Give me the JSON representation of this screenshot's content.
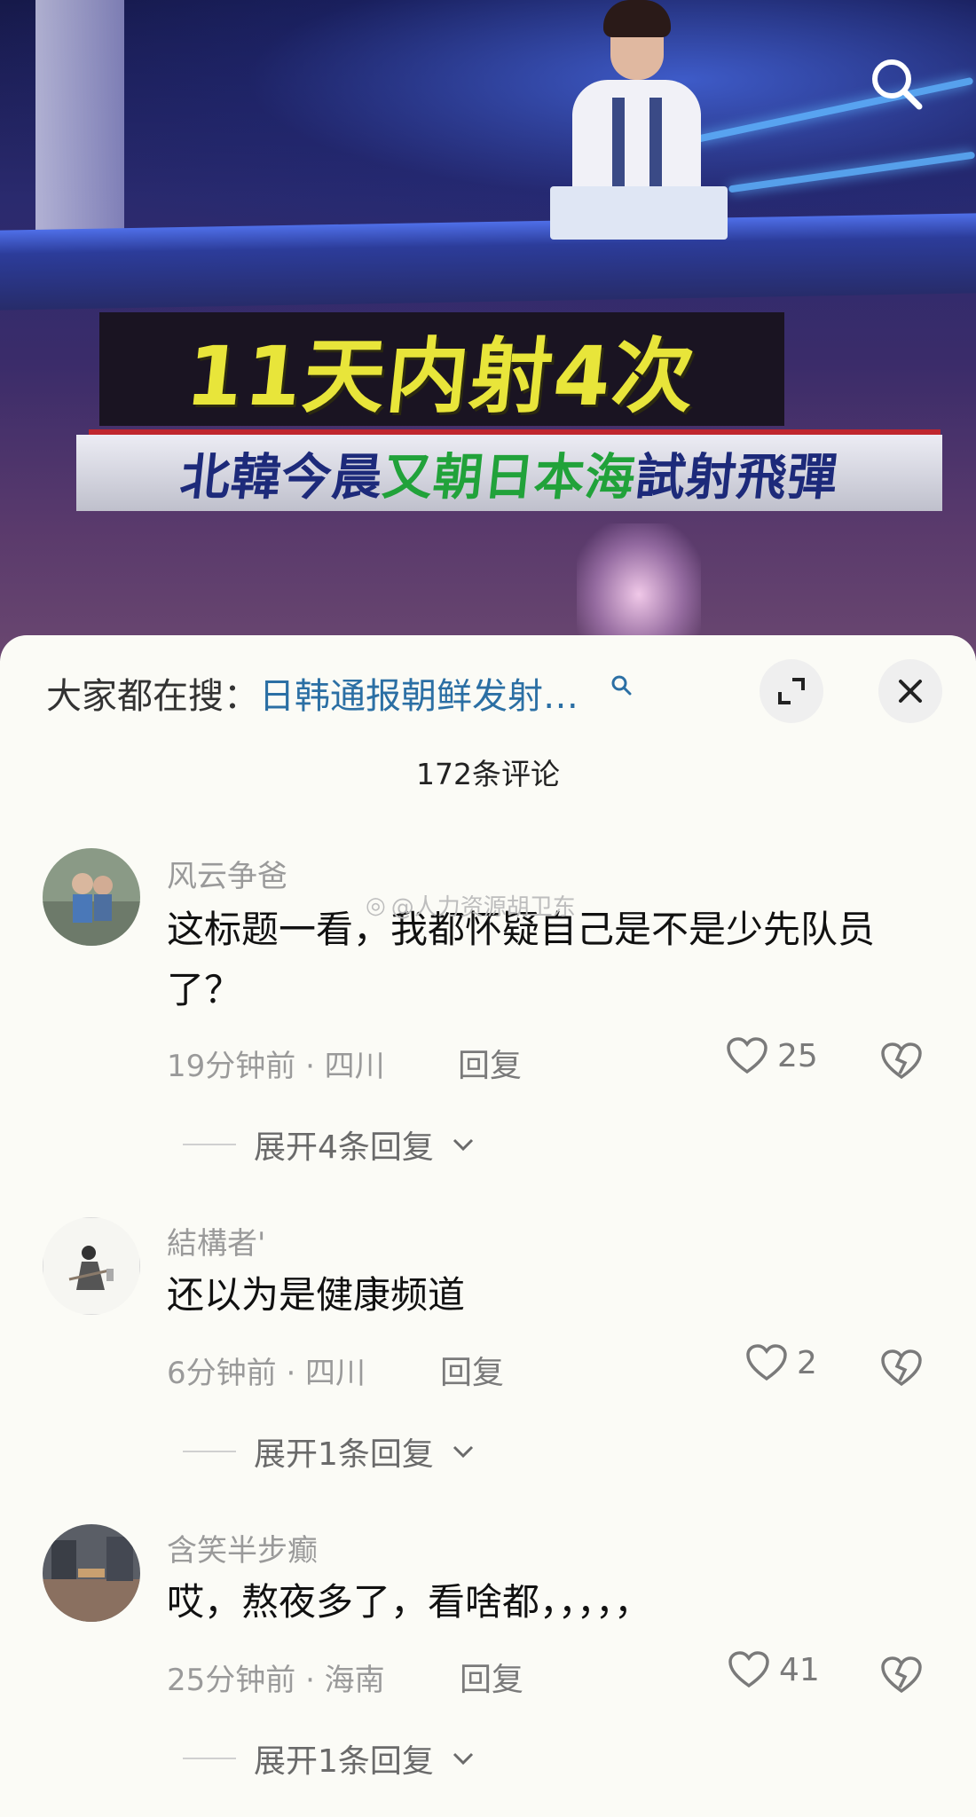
{
  "video": {
    "headline_yellow": "11天内射4次",
    "subtitle_part1": "北韓今晨",
    "subtitle_part2": "又朝日本海",
    "subtitle_part3": "試射飛彈"
  },
  "trend": {
    "label": "大家都在搜：",
    "query": "日韩通报朝鲜发射…"
  },
  "comment_count": "172条评论",
  "watermark": "@人力资源胡卫东",
  "comments": [
    {
      "username": "风云争爸",
      "text": "这标题一看，我都怀疑自己是不是少先队员了？",
      "time_location": "19分钟前 · 四川",
      "reply_label": "回复",
      "likes": "25",
      "expand_label": "展开4条回复"
    },
    {
      "username": "結構者'",
      "text": "还以为是健康频道",
      "time_location": "6分钟前 · 四川",
      "reply_label": "回复",
      "likes": "2",
      "expand_label": "展开1条回复"
    },
    {
      "username": "含笑半步癫",
      "text": "哎，熬夜多了，看啥都，，，，，",
      "time_location": "25分钟前 · 海南",
      "reply_label": "回复",
      "likes": "41",
      "expand_label": "展开1条回复"
    }
  ],
  "icons": {
    "search": "search-icon",
    "expand": "expand-icon",
    "close": "close-icon",
    "like": "heart-icon",
    "dislike": "broken-heart-icon",
    "chevron": "chevron-down-icon"
  },
  "colors": {
    "link": "#2b6fa4",
    "headline": "#e8e53a",
    "subtitle_green": "#21a23a"
  }
}
